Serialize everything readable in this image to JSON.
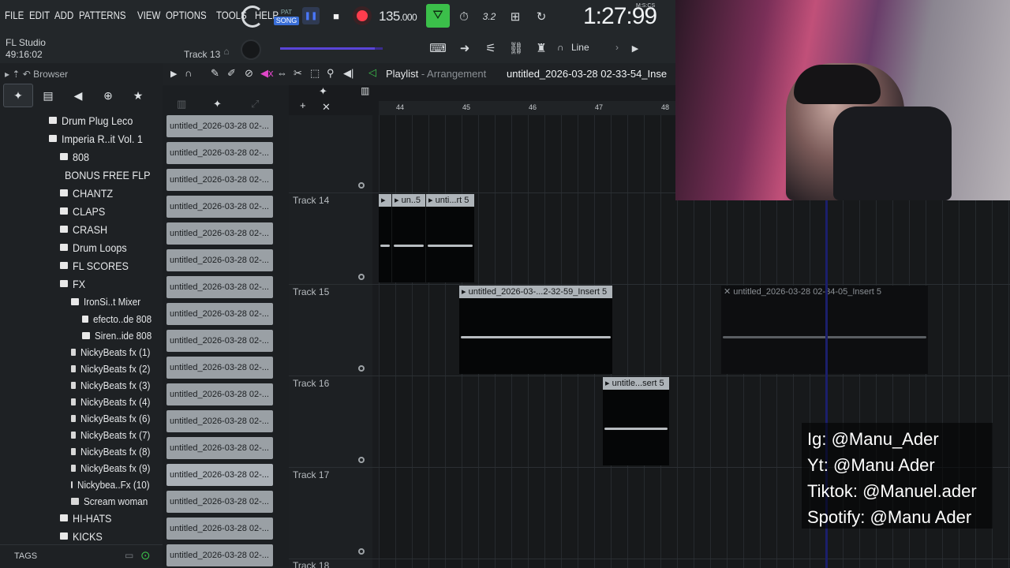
{
  "menu": [
    "FILE",
    "EDIT",
    "ADD",
    "PATTERNS",
    "VIEW",
    "OPTIONS",
    "TOOLS",
    "HELP"
  ],
  "transport": {
    "pattern_label": "PAT",
    "song_label": "SONG",
    "tempo": "135",
    "tempo_decimals": ".000",
    "time": "1:27:99",
    "time_format": "M:S:CS"
  },
  "app": {
    "name": "FL Studio",
    "elapsed": "49:16:02",
    "hint_track": "Track 13"
  },
  "snap": {
    "value": "Line"
  },
  "browser": {
    "title": "Browser",
    "tags_label": "TAGS",
    "items": [
      {
        "label": "Drum Plug Leco",
        "level": 1
      },
      {
        "label": "Imperia R..it Vol. 1",
        "level": 1
      },
      {
        "label": "808",
        "level": 2
      },
      {
        "label": "BONUS FREE FLP",
        "level": 2
      },
      {
        "label": "CHANTZ",
        "level": 2
      },
      {
        "label": "CLAPS",
        "level": 2
      },
      {
        "label": "CRASH",
        "level": 2
      },
      {
        "label": "Drum Loops",
        "level": 2
      },
      {
        "label": "FL SCORES",
        "level": 2
      },
      {
        "label": "FX",
        "level": 2
      },
      {
        "label": "IronSi..t Mixer",
        "level": 3
      },
      {
        "label": "efecto..de 808",
        "level": 4
      },
      {
        "label": "Siren..ide 808",
        "level": 4
      },
      {
        "label": "NickyBeats fx (1)",
        "level": 3
      },
      {
        "label": "NickyBeats fx (2)",
        "level": 3
      },
      {
        "label": "NickyBeats fx (3)",
        "level": 3
      },
      {
        "label": "NickyBeats fx (4)",
        "level": 3
      },
      {
        "label": "NickyBeats fx (6)",
        "level": 3
      },
      {
        "label": "NickyBeats fx (7)",
        "level": 3
      },
      {
        "label": "NickyBeats fx (8)",
        "level": 3
      },
      {
        "label": "NickyBeats fx (9)",
        "level": 3
      },
      {
        "label": "Nickybea..Fx (10)",
        "level": 3
      },
      {
        "label": "Scream woman",
        "level": 3
      },
      {
        "label": "HI-HATS",
        "level": 2
      },
      {
        "label": "KICKS",
        "level": 2
      }
    ]
  },
  "clips_list": {
    "label": "untitled_2026-03-28 02-...",
    "count": 17,
    "selected_index": 13
  },
  "playlist": {
    "title": "Playlist",
    "subtitle": "Arrangement",
    "arrangement_name": "untitled_2026-03-28 02-33-54_Inse",
    "ruler": [
      "44",
      "45",
      "46",
      "47",
      "48"
    ],
    "tracks": [
      "Track 14",
      "Track 15",
      "Track 16",
      "Track 17",
      "Track 18"
    ],
    "clips": {
      "t14_a": "",
      "t14_b": "un..5",
      "t14_c": "unti...rt 5",
      "t15_a": "untitled_2026-03-...2-32-59_Insert 5",
      "t15_b": "untitled_2026-03-28 02-34-05_Insert 5",
      "t16_a": "untitle...sert 5"
    }
  },
  "socials": [
    "Ig: @Manu_Ader",
    "Yt: @Manu Ader",
    "Tiktok: @Manuel.ader",
    "Spotify: @Manu Ader"
  ]
}
